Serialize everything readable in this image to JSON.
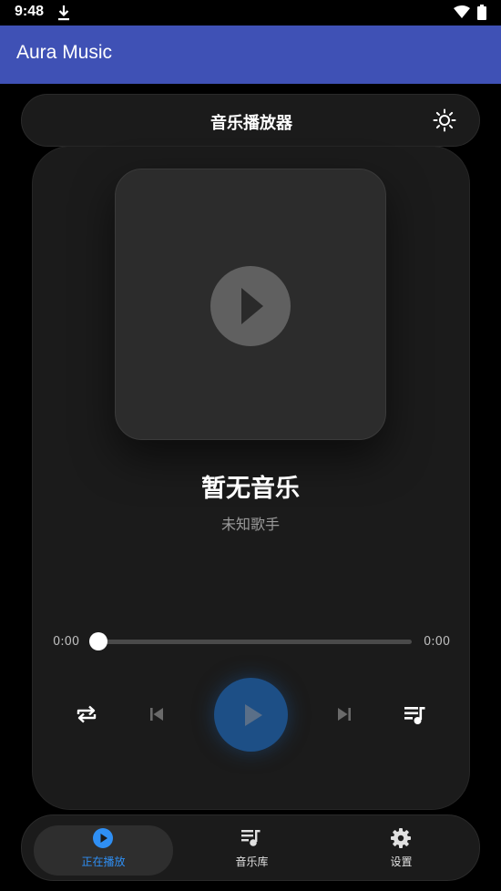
{
  "status_bar": {
    "time": "9:48"
  },
  "app_bar": {
    "title": "Aura Music"
  },
  "header": {
    "title": "音乐播放器"
  },
  "now_playing": {
    "title": "暂无音乐",
    "artist": "未知歌手"
  },
  "progress": {
    "current": "0:00",
    "total": "0:00",
    "fraction": 0.0
  },
  "controls": {
    "icons": [
      "repeat-icon",
      "skip-previous-icon",
      "play-icon",
      "skip-next-icon",
      "playlist-icon"
    ]
  },
  "bottom_nav": {
    "items": [
      {
        "label": "正在播放",
        "icon": "play-circle-icon",
        "active": true
      },
      {
        "label": "音乐库",
        "icon": "library-music-icon",
        "active": false
      },
      {
        "label": "设置",
        "icon": "settings-gear-icon",
        "active": false
      }
    ]
  },
  "colors": {
    "app_bar": "#3f51b5",
    "background": "#000000",
    "card": "#1b1b1b",
    "accent": "#2f8ff4",
    "play_button": "#1d4f86",
    "muted_text": "#9a9a9a"
  }
}
